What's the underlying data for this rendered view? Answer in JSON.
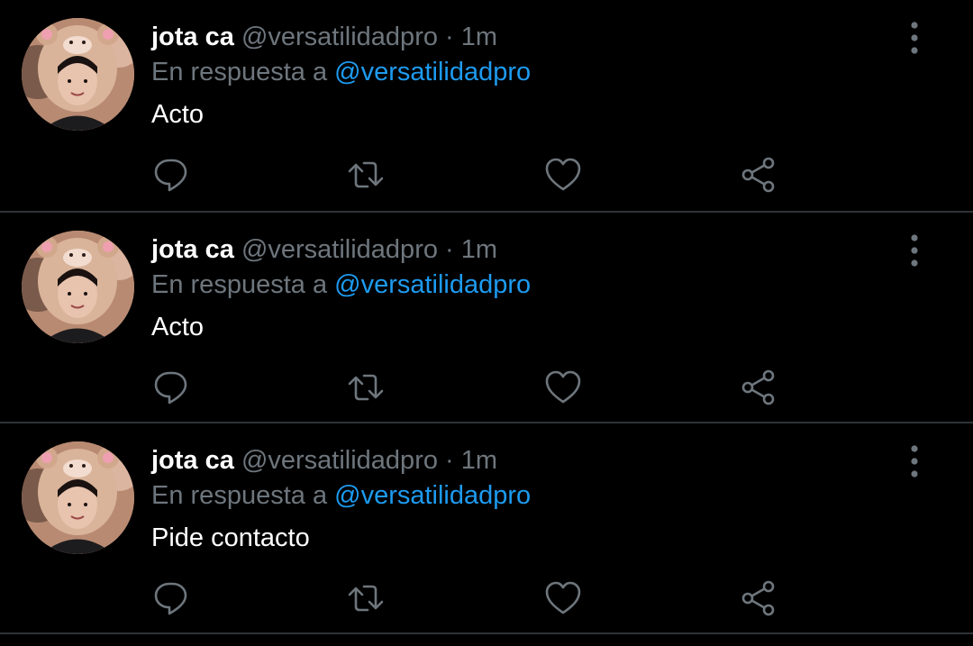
{
  "colors": {
    "background": "#000000",
    "divider": "#2f3336",
    "muted": "#6e767d",
    "accent": "#1d9bf0",
    "text": "#ffffff"
  },
  "tweets": [
    {
      "name": "jota ca",
      "handle": "@versatilidadpro",
      "separator": "·",
      "time": "1m",
      "reply_prefix": "En respuesta a",
      "reply_to": "@versatilidadpro",
      "text": "Acto",
      "avatar_icon": "avatar-bear-hat",
      "actions": [
        "reply-icon",
        "retweet-icon",
        "like-icon",
        "share-icon"
      ]
    },
    {
      "name": "jota ca",
      "handle": "@versatilidadpro",
      "separator": "·",
      "time": "1m",
      "reply_prefix": "En respuesta a",
      "reply_to": "@versatilidadpro",
      "text": "Acto",
      "avatar_icon": "avatar-bear-hat",
      "actions": [
        "reply-icon",
        "retweet-icon",
        "like-icon",
        "share-icon"
      ]
    },
    {
      "name": "jota ca",
      "handle": "@versatilidadpro",
      "separator": "·",
      "time": "1m",
      "reply_prefix": "En respuesta a",
      "reply_to": "@versatilidadpro",
      "text": "Pide contacto",
      "avatar_icon": "avatar-bear-hat",
      "actions": [
        "reply-icon",
        "retweet-icon",
        "like-icon",
        "share-icon"
      ]
    }
  ]
}
